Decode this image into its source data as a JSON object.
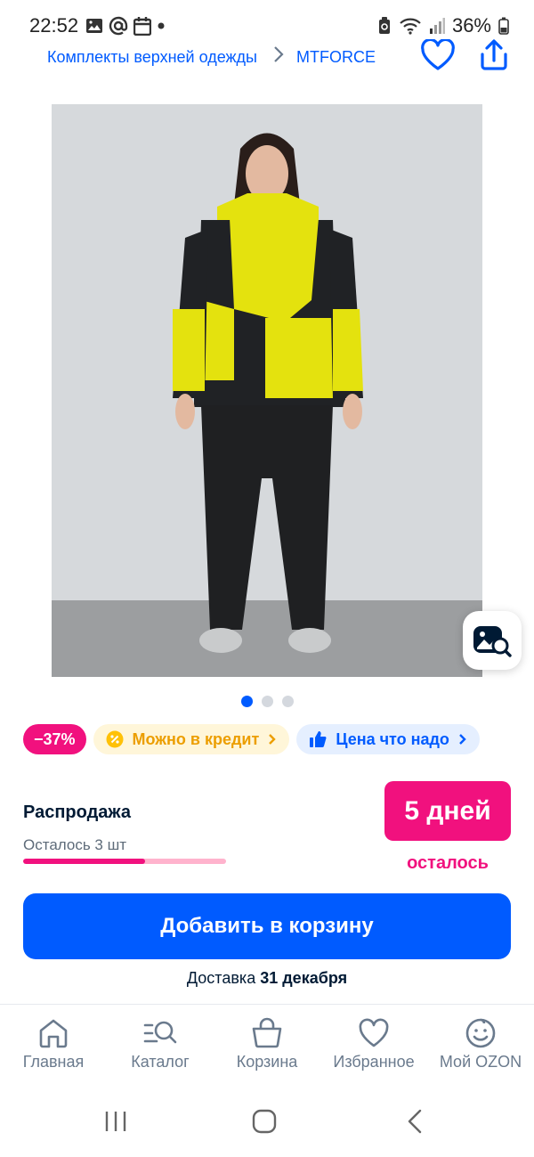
{
  "status": {
    "time": "22:52",
    "battery": "36%"
  },
  "breadcrumb": {
    "category": "Комплекты верхней одежды",
    "brand": "MTFORCE"
  },
  "gallery": {
    "current_index": 1,
    "total": 3
  },
  "chips": {
    "discount": "−37%",
    "credit": "Можно в кредит",
    "price": "Цена что надо"
  },
  "sale": {
    "title": "Распродажа",
    "remaining": "Осталось 3 шт",
    "stock_fraction": 0.6,
    "days_badge": "5 дней",
    "days_caption": "осталось"
  },
  "cart": {
    "button_label": "Добавить в корзину",
    "delivery_prefix": "Доставка",
    "delivery_date": "31 декабря"
  },
  "tabbar": {
    "items": [
      {
        "label": "Главная",
        "icon": "home-icon"
      },
      {
        "label": "Каталог",
        "icon": "catalog-icon"
      },
      {
        "label": "Корзина",
        "icon": "cart-icon"
      },
      {
        "label": "Избранное",
        "icon": "heart-icon"
      },
      {
        "label": "Мой OZON",
        "icon": "profile-icon"
      }
    ]
  },
  "colors": {
    "brand_blue": "#005bff",
    "accent_pink": "#f1117e",
    "credit_yellow": "#ec9e00"
  }
}
